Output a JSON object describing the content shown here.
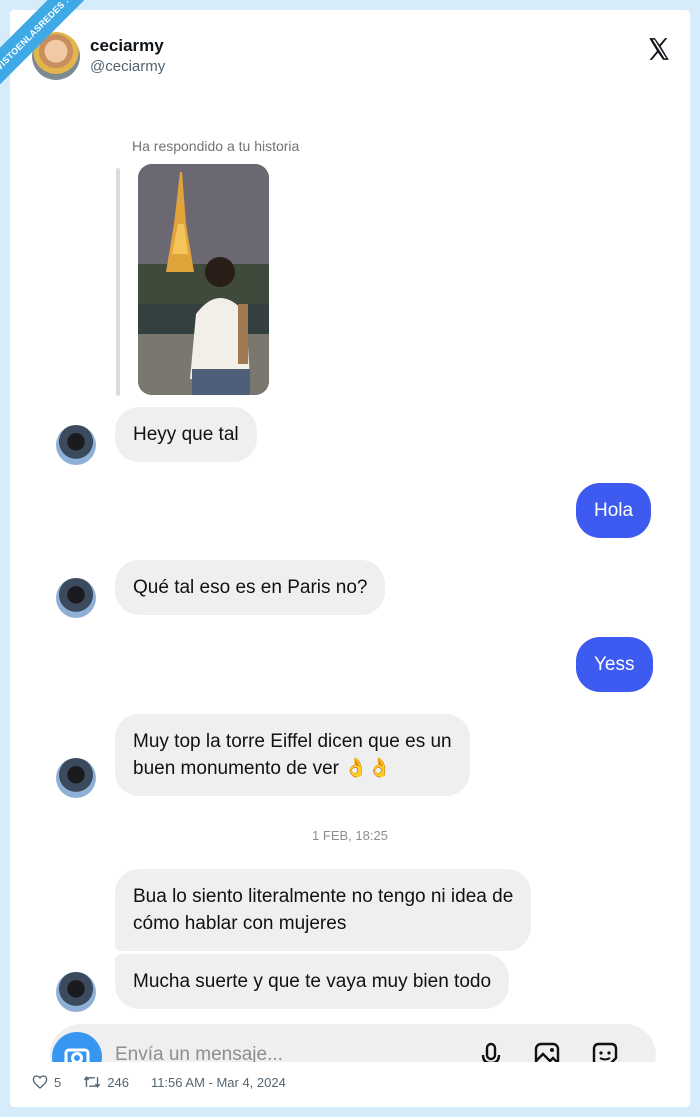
{
  "watermark": {
    "text": "VISTOENLASREDES .com"
  },
  "tweet": {
    "author_name": "ceciarmy",
    "author_handle": "@ceciarmy",
    "likes": "5",
    "retweets": "246",
    "timestamp": "11:56 AM - Mar 4, 2024"
  },
  "chat": {
    "story_label": "Ha respondido a tu historia",
    "date_separator": "1 FEB, 18:25",
    "messages": [
      {
        "from": "them",
        "text": "Heyy que tal"
      },
      {
        "from": "me",
        "text": "Hola"
      },
      {
        "from": "them",
        "text": "Qué tal eso es en Paris no?"
      },
      {
        "from": "me",
        "text": "Yess"
      },
      {
        "from": "them",
        "line1": "Muy top la torre Eiffel dicen que es un",
        "line2": " buen monumento de ver 👌👌"
      },
      {
        "from": "them",
        "line1": "Bua lo siento literalmente no tengo ni idea de",
        "line2": "cómo hablar con mujeres"
      },
      {
        "from": "them",
        "text": "Mucha suerte y que te vaya muy bien todo"
      }
    ],
    "composer_placeholder": "Envía un mensaje..."
  },
  "icons": [
    "x-logo-icon",
    "camera-icon",
    "microphone-icon",
    "gallery-icon",
    "sticker-icon",
    "heart-icon",
    "retweet-icon"
  ],
  "colors": {
    "my_bubble": "#3d5af1",
    "their_bubble": "#efefef",
    "camera_button": "#3797f0",
    "ribbon": "#3fa9e6"
  }
}
